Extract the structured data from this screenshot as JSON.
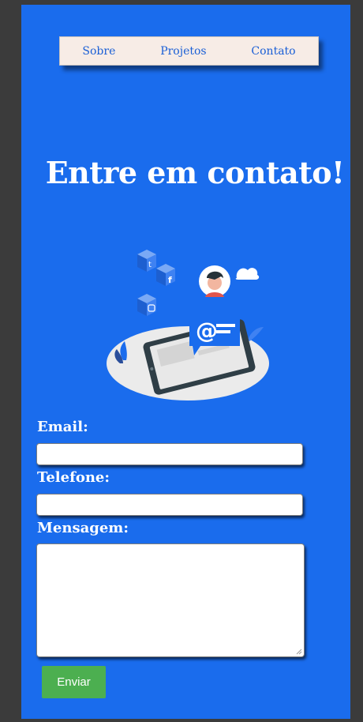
{
  "nav": {
    "items": [
      "Sobre",
      "Projetos",
      "Contato"
    ]
  },
  "hero": {
    "title": "Entre em contato!"
  },
  "form": {
    "email_label": "Email:",
    "phone_label": "Telefone:",
    "message_label": "Mensagem:",
    "email_value": "",
    "phone_value": "",
    "message_value": "",
    "submit_label": "Enviar"
  },
  "colors": {
    "background": "#1a6ced",
    "nav_background": "#f7ece6",
    "submit_button": "#4caf50"
  }
}
